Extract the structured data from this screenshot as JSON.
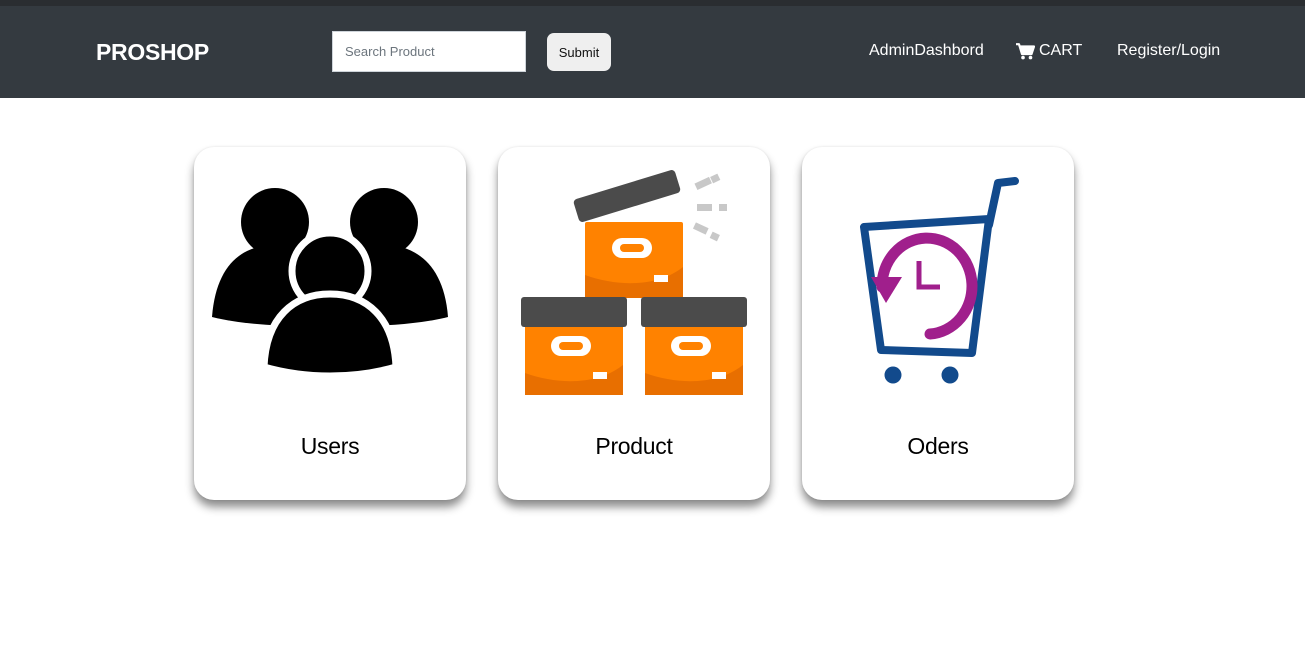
{
  "navbar": {
    "brand": "PROSHOP",
    "search": {
      "placeholder": "Search Product",
      "value": ""
    },
    "submit_label": "Submit",
    "links": {
      "admin": "AdminDashbord",
      "cart": "CART",
      "auth": "Register/Login"
    }
  },
  "cards": {
    "users": {
      "label": "Users",
      "icon": "users-icon"
    },
    "product": {
      "label": "Product",
      "icon": "boxes-icon"
    },
    "orders": {
      "label": "Oders",
      "icon": "cart-history-icon"
    }
  },
  "colors": {
    "navbar_bg": "#343a40",
    "box_orange": "#ff7f00",
    "lid_gray": "#4a4a4a",
    "cart_blue": "#124a8c",
    "clock_magenta": "#a01f8c"
  }
}
